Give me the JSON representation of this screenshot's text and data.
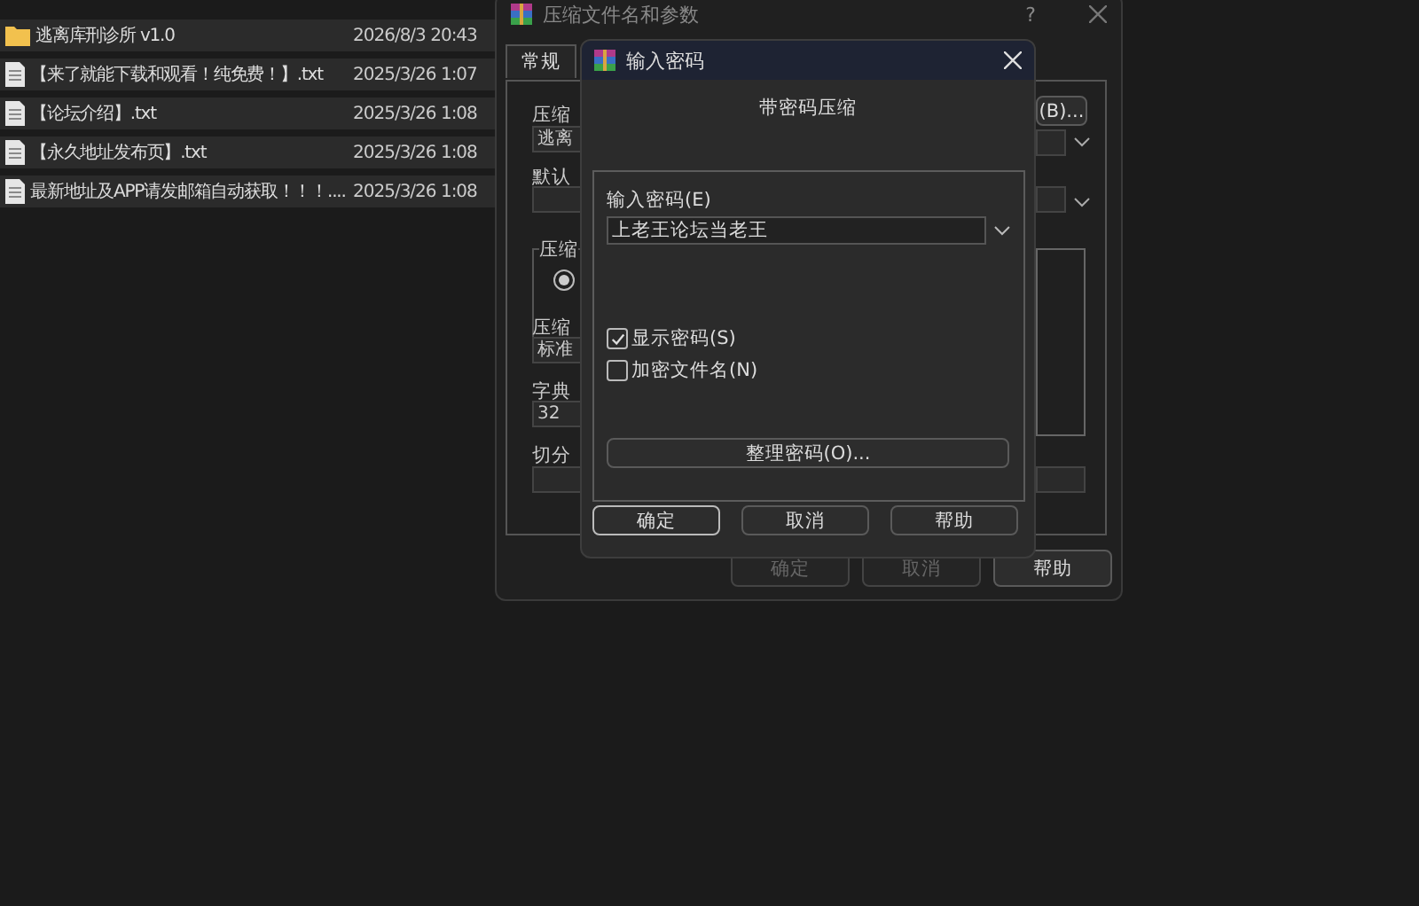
{
  "file_list": {
    "rows": [
      {
        "kind": "folder",
        "name": "逃离库刑诊所 v1.0",
        "modified": "2026/8/3 20:43"
      },
      {
        "kind": "file",
        "name": "【来了就能下载和观看！纯免费！】.txt",
        "modified": "2025/3/26 1:07"
      },
      {
        "kind": "file",
        "name": "【论坛介绍】.txt",
        "modified": "2025/3/26 1:08"
      },
      {
        "kind": "file",
        "name": "【永久地址发布页】.txt",
        "modified": "2025/3/26 1:08"
      },
      {
        "kind": "file",
        "name": "最新地址及APP请发邮箱自动获取！！！....",
        "modified": "2025/3/26 1:08"
      }
    ]
  },
  "archive_dialog": {
    "title": "压缩文件名和参数",
    "help": "?",
    "tabs": [
      {
        "label": "常规",
        "selected": true
      }
    ],
    "archive_name_label": "压缩",
    "archive_name_value": "逃离",
    "browse_button": "(B)...",
    "profile_label": "默认",
    "group_label": "压缩",
    "radio_selected": true,
    "method_label": "压缩",
    "method_value": "标准",
    "dictionary_label": "字典",
    "dictionary_value": "32",
    "split_label": "切分",
    "buttons": [
      {
        "label": "确定",
        "disabled": true
      },
      {
        "label": "取消",
        "disabled": true
      },
      {
        "label": "帮助",
        "disabled": false
      }
    ]
  },
  "password_dialog": {
    "title": "输入密码",
    "heading": "带密码压缩",
    "password_label": "输入密码(E)",
    "password_value": "上老王论坛当老王",
    "checkboxes": [
      {
        "label": "显示密码(S)",
        "checked": true
      },
      {
        "label": "加密文件名(N)",
        "checked": false
      }
    ],
    "organize_button": "整理密码(O)...",
    "buttons": [
      {
        "label": "确定",
        "focused": true
      },
      {
        "label": "取消",
        "focused": false
      },
      {
        "label": "帮助",
        "focused": false
      }
    ]
  }
}
